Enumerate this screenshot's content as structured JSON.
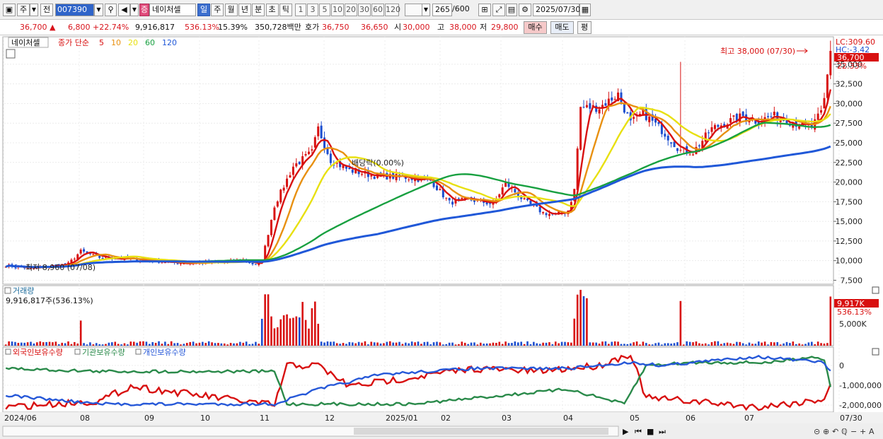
{
  "toolbar": {
    "market": "주",
    "prev": "전",
    "code": "007390",
    "name": "네이처셀",
    "name_flag": "증",
    "periods": [
      "일",
      "주",
      "월",
      "년",
      "분",
      "초",
      "틱"
    ],
    "intervals": [
      "1",
      "3",
      "5",
      "10",
      "20",
      "30",
      "60",
      "120"
    ],
    "count": "265",
    "count_total": "/600",
    "date": "2025/07/30"
  },
  "quote": {
    "price": "36,700",
    "change": "6,800",
    "change_pct": "+22.74%",
    "volume": "9,916,817",
    "volume_ratio": "536.13%",
    "turnover": "15.39%",
    "amount": "350,728백만",
    "hoga_label": "호가",
    "ask": "36,750",
    "bid": "36,650",
    "open_label": "시",
    "open": "30,000",
    "high_label": "고",
    "high": "38,000",
    "low_label": "저",
    "low": "29,800",
    "buy_label": "매수",
    "sell_label": "매도",
    "eval_label": "평"
  },
  "price_panel": {
    "legend_name": "네이처셀",
    "legend_type": "종가 단순",
    "ma_labels": [
      "5",
      "10",
      "20",
      "60",
      "120"
    ],
    "ma_colors": [
      "#d81010",
      "#e89010",
      "#e8e010",
      "#18a040",
      "#2058d8"
    ],
    "lc": "LC:309.60",
    "hc": "HC:-3.42",
    "last_price_tag": "36,700",
    "last_pct_tag": "22.33%",
    "high_note": "최고 38,000 (07/30)",
    "low_note": "최저 8,960 (07/08)",
    "dividend_note": "배당락(0.00%)"
  },
  "volume_panel": {
    "title": "거래량",
    "value": "9,916,817주(536.13%)",
    "tag_value": "9,917K",
    "tag_pct": "536.13%",
    "axis_label": "5,000K"
  },
  "holding_panel": {
    "labels": [
      "외국인보유수량",
      "기관보유수량",
      "개인보유수량"
    ],
    "axis_labels": [
      "0",
      "-1,000,000",
      "-2,000,000"
    ]
  },
  "x_axis": [
    "2024/06",
    "08",
    "09",
    "10",
    "11",
    "12",
    "2025/01",
    "02",
    "03",
    "04",
    "05",
    "06",
    "07",
    "07/30"
  ],
  "chart_data": [
    {
      "type": "candlestick",
      "title": "네이처셀",
      "x": [
        "2024/06",
        "08",
        "09",
        "10",
        "11",
        "12",
        "2025/01",
        "02",
        "03",
        "04",
        "05",
        "06",
        "07/30"
      ],
      "close": [
        9400,
        10600,
        10000,
        9900,
        23000,
        21500,
        20000,
        17800,
        16000,
        29000,
        25000,
        27500,
        36700
      ],
      "ma_periods": [
        5,
        10,
        20,
        60,
        120
      ],
      "ylim": [
        7000,
        38500
      ],
      "yticks": [
        7500,
        10000,
        12500,
        15000,
        17500,
        20000,
        22500,
        25000,
        27500,
        30000,
        32500,
        35000
      ],
      "high": 38000,
      "low": 8960
    },
    {
      "type": "bar",
      "title": "거래량",
      "last_value": 9916817,
      "yticks": [
        5000000
      ]
    },
    {
      "type": "line",
      "series": [
        {
          "name": "외국인보유수량",
          "color": "#d81010"
        },
        {
          "name": "기관보유수량",
          "color": "#2a8a4a"
        },
        {
          "name": "개인보유수량",
          "color": "#2658d8"
        }
      ],
      "yticks": [
        0,
        -1000000,
        -2000000
      ]
    }
  ]
}
